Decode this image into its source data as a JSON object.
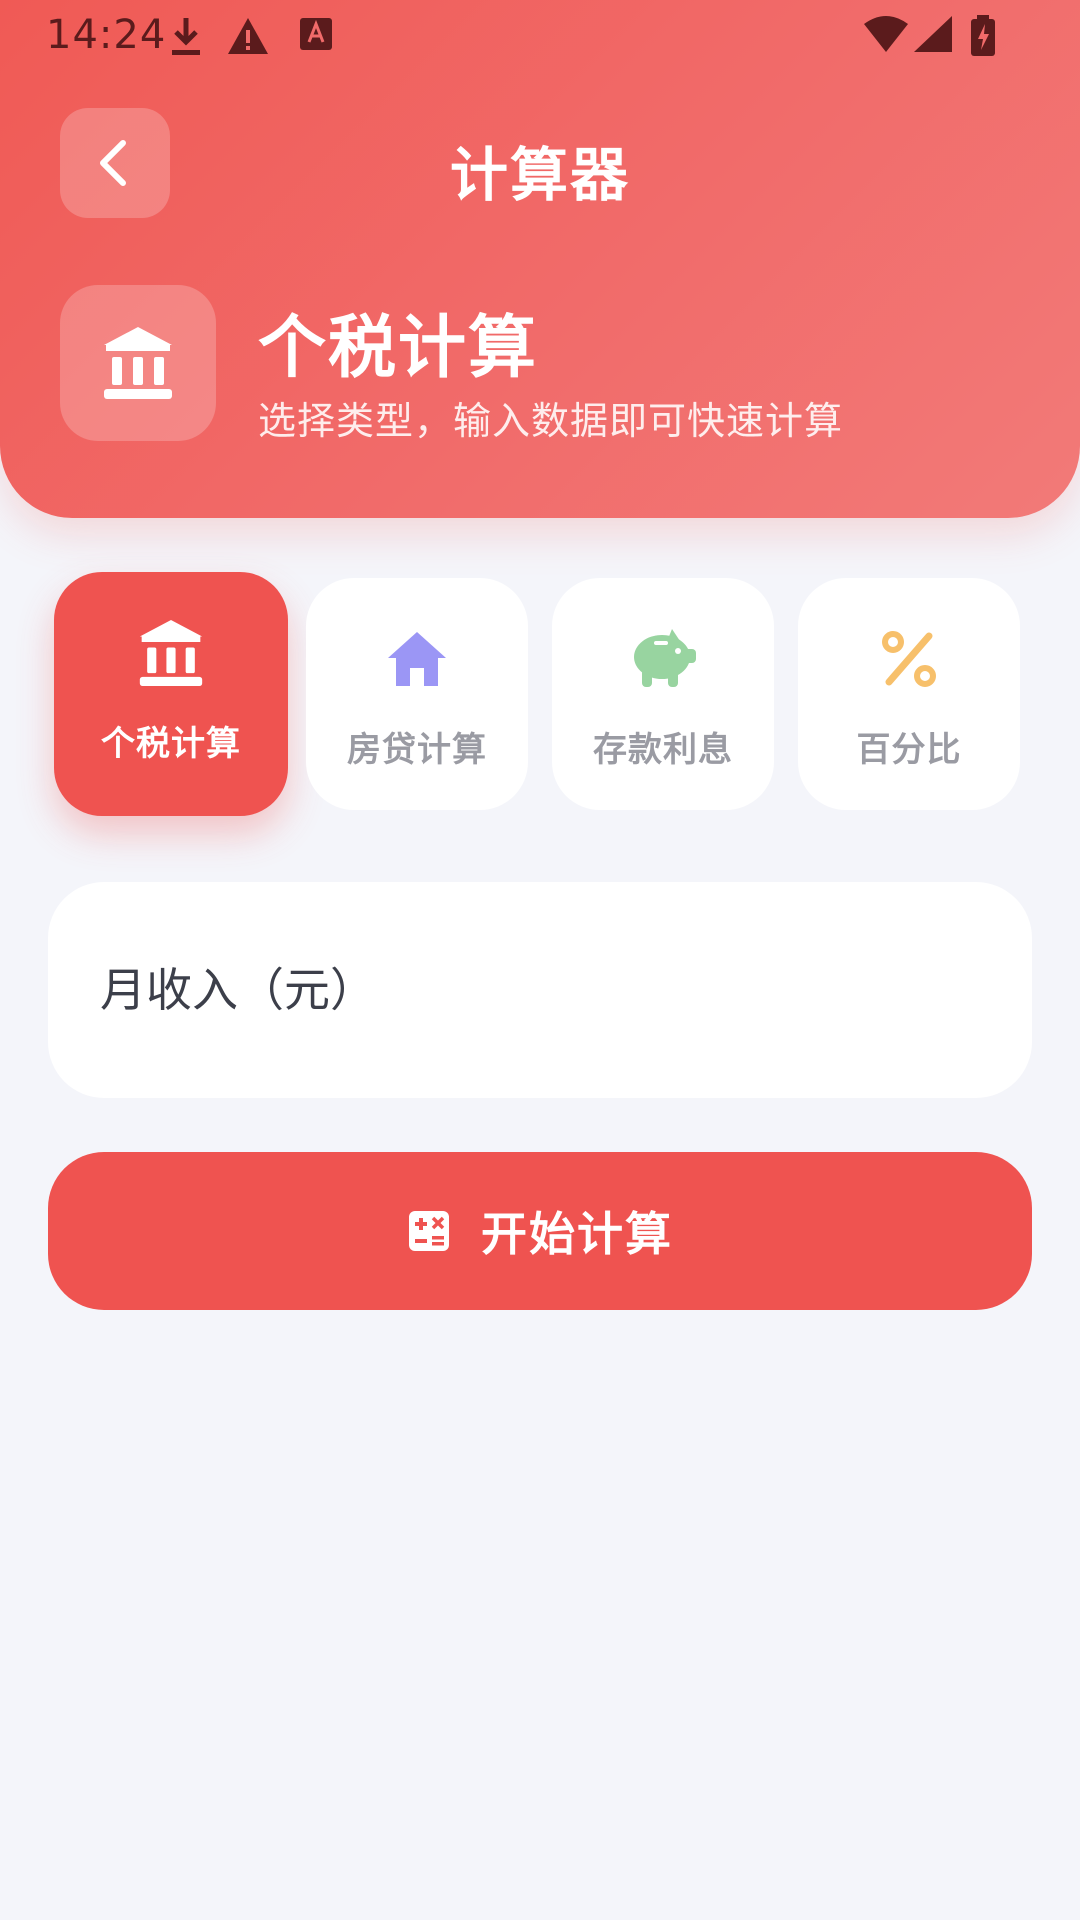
{
  "status_bar": {
    "time": "14:24",
    "icons": [
      "download-icon",
      "warning-icon",
      "text-a-icon",
      "wifi-icon",
      "signal-icon",
      "battery-charging-icon"
    ]
  },
  "header": {
    "title": "计算器",
    "back_icon": "chevron-left-icon",
    "hero": {
      "icon": "bank-icon",
      "title": "个税计算",
      "subtitle": "选择类型，输入数据即可快速计算"
    }
  },
  "tabs": [
    {
      "label": "个税计算",
      "icon": "bank-icon",
      "active": true,
      "icon_color": "#ffffff"
    },
    {
      "label": "房贷计算",
      "icon": "house-icon",
      "active": false,
      "icon_color": "#9b96f5"
    },
    {
      "label": "存款利息",
      "icon": "piggy-bank-icon",
      "active": false,
      "icon_color": "#98d4a0"
    },
    {
      "label": "百分比",
      "icon": "percent-icon",
      "active": false,
      "icon_color": "#f7c06b"
    }
  ],
  "form": {
    "income_placeholder": "月收入（元）",
    "income_value": ""
  },
  "action": {
    "label": "开始计算",
    "icon": "calculator-icon"
  },
  "colors": {
    "primary": "#ef5350",
    "background": "#f4f5fa",
    "status_text": "#5b1b1c"
  }
}
